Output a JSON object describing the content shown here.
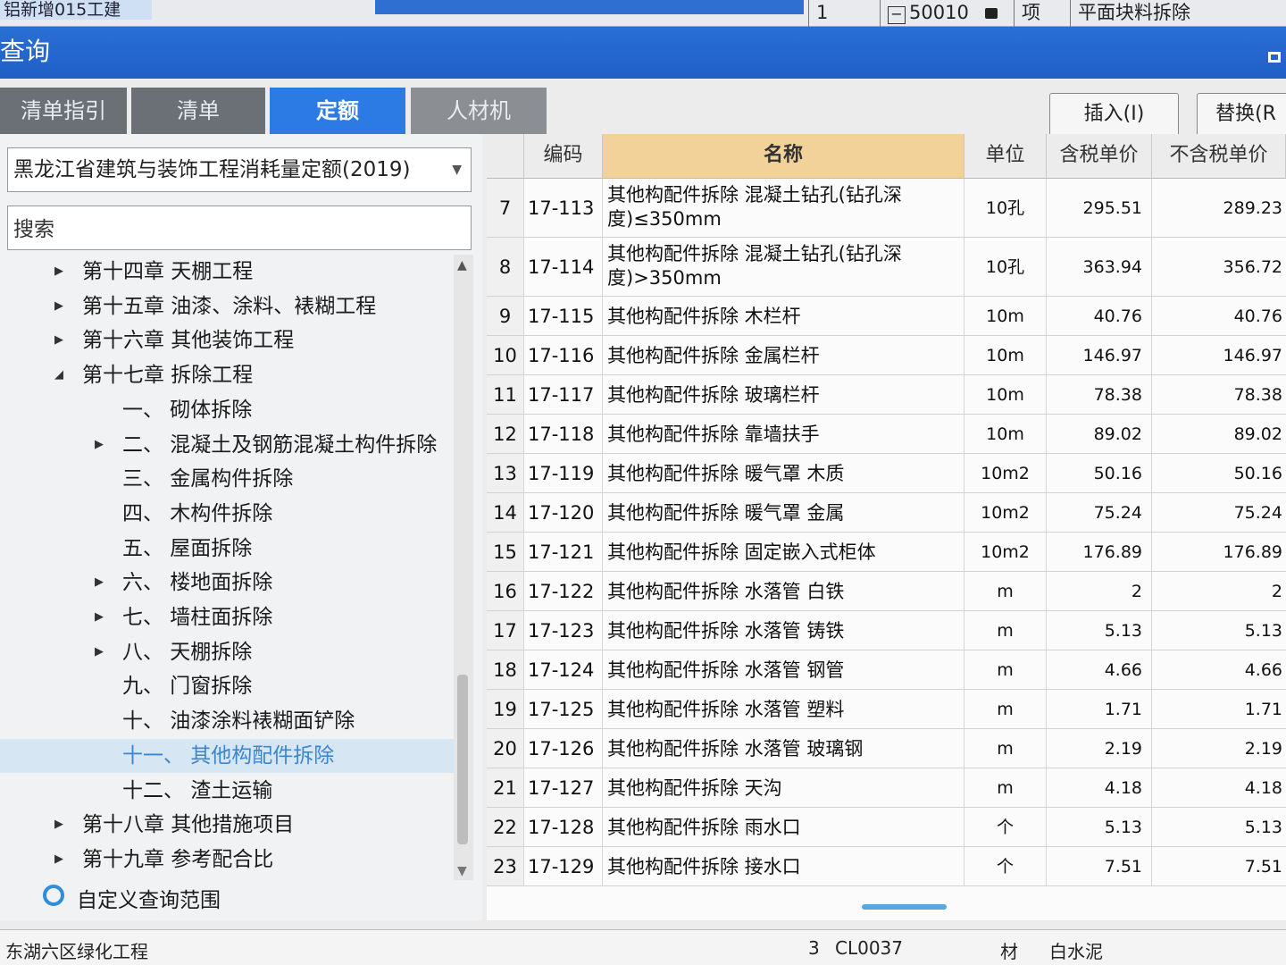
{
  "topbar": {
    "project": "铝新增015工建",
    "page_number": "1",
    "code": "50010",
    "type": "项",
    "item_name": "平面块料拆除"
  },
  "window": {
    "title": "查询"
  },
  "tabs": [
    {
      "label": "清单指引",
      "active": false
    },
    {
      "label": "清单",
      "active": false
    },
    {
      "label": "定额",
      "active": true
    },
    {
      "label": "人材机",
      "active": false
    }
  ],
  "actions": {
    "insert_label": "插入(I)",
    "replace_label": "替换(R"
  },
  "left_panel": {
    "library": "黑龙江省建筑与装饰工程消耗量定额(2019)",
    "search_placeholder": "搜索",
    "tree": [
      {
        "label": "第十四章 天棚工程",
        "state": "collapsed",
        "level": 0
      },
      {
        "label": "第十五章 油漆、涂料、裱糊工程",
        "state": "collapsed",
        "level": 0
      },
      {
        "label": "第十六章 其他装饰工程",
        "state": "collapsed",
        "level": 0
      },
      {
        "label": "第十七章 拆除工程",
        "state": "expanded",
        "level": 0
      },
      {
        "label": "一、 砌体拆除",
        "state": "leaf",
        "level": 1
      },
      {
        "label": "二、 混凝土及钢筋混凝土构件拆除",
        "state": "collapsed",
        "level": 1
      },
      {
        "label": "三、 金属构件拆除",
        "state": "leaf",
        "level": 1
      },
      {
        "label": "四、 木构件拆除",
        "state": "leaf",
        "level": 1
      },
      {
        "label": "五、 屋面拆除",
        "state": "leaf",
        "level": 1
      },
      {
        "label": "六、 楼地面拆除",
        "state": "collapsed",
        "level": 1
      },
      {
        "label": "七、 墙柱面拆除",
        "state": "collapsed",
        "level": 1
      },
      {
        "label": "八、 天棚拆除",
        "state": "collapsed",
        "level": 1
      },
      {
        "label": "九、 门窗拆除",
        "state": "leaf",
        "level": 1
      },
      {
        "label": "十、 油漆涂料裱糊面铲除",
        "state": "leaf",
        "level": 1
      },
      {
        "label": "十一、 其他构配件拆除",
        "state": "leaf",
        "level": 1,
        "selected": true
      },
      {
        "label": "十二、 渣土运输",
        "state": "leaf",
        "level": 1
      },
      {
        "label": "第十八章 其他措施项目",
        "state": "collapsed",
        "level": 0
      },
      {
        "label": "第十九章 参考配合比",
        "state": "collapsed",
        "level": 0
      }
    ],
    "custom_scope": "自定义查询范围"
  },
  "grid": {
    "headers": [
      "",
      "编码",
      "名称",
      "单位",
      "含税单价",
      "不含税单价"
    ],
    "rows": [
      {
        "no": "7",
        "code": "17-113",
        "name": "其他构配件拆除 混凝土钻孔(钻孔深度)≤350mm",
        "unit": "10孔",
        "price_tax": "295.51",
        "price_notax": "289.23"
      },
      {
        "no": "8",
        "code": "17-114",
        "name": "其他构配件拆除 混凝土钻孔(钻孔深度)>350mm",
        "unit": "10孔",
        "price_tax": "363.94",
        "price_notax": "356.72"
      },
      {
        "no": "9",
        "code": "17-115",
        "name": "其他构配件拆除 木栏杆",
        "unit": "10m",
        "price_tax": "40.76",
        "price_notax": "40.76"
      },
      {
        "no": "10",
        "code": "17-116",
        "name": "其他构配件拆除 金属栏杆",
        "unit": "10m",
        "price_tax": "146.97",
        "price_notax": "146.97"
      },
      {
        "no": "11",
        "code": "17-117",
        "name": "其他构配件拆除 玻璃栏杆",
        "unit": "10m",
        "price_tax": "78.38",
        "price_notax": "78.38"
      },
      {
        "no": "12",
        "code": "17-118",
        "name": "其他构配件拆除 靠墙扶手",
        "unit": "10m",
        "price_tax": "89.02",
        "price_notax": "89.02"
      },
      {
        "no": "13",
        "code": "17-119",
        "name": "其他构配件拆除 暖气罩 木质",
        "unit": "10m2",
        "price_tax": "50.16",
        "price_notax": "50.16"
      },
      {
        "no": "14",
        "code": "17-120",
        "name": "其他构配件拆除 暖气罩 金属",
        "unit": "10m2",
        "price_tax": "75.24",
        "price_notax": "75.24"
      },
      {
        "no": "15",
        "code": "17-121",
        "name": "其他构配件拆除 固定嵌入式柜体",
        "unit": "10m2",
        "price_tax": "176.89",
        "price_notax": "176.89"
      },
      {
        "no": "16",
        "code": "17-122",
        "name": "其他构配件拆除 水落管 白铁",
        "unit": "m",
        "price_tax": "2",
        "price_notax": "2"
      },
      {
        "no": "17",
        "code": "17-123",
        "name": "其他构配件拆除 水落管 铸铁",
        "unit": "m",
        "price_tax": "5.13",
        "price_notax": "5.13"
      },
      {
        "no": "18",
        "code": "17-124",
        "name": "其他构配件拆除 水落管 钢管",
        "unit": "m",
        "price_tax": "4.66",
        "price_notax": "4.66"
      },
      {
        "no": "19",
        "code": "17-125",
        "name": "其他构配件拆除 水落管 塑料",
        "unit": "m",
        "price_tax": "1.71",
        "price_notax": "1.71"
      },
      {
        "no": "20",
        "code": "17-126",
        "name": "其他构配件拆除 水落管 玻璃钢",
        "unit": "m",
        "price_tax": "2.19",
        "price_notax": "2.19"
      },
      {
        "no": "21",
        "code": "17-127",
        "name": "其他构配件拆除 天沟",
        "unit": "m",
        "price_tax": "4.18",
        "price_notax": "4.18"
      },
      {
        "no": "22",
        "code": "17-128",
        "name": "其他构配件拆除 雨水口",
        "unit": "个",
        "price_tax": "5.13",
        "price_notax": "5.13"
      },
      {
        "no": "23",
        "code": "17-129",
        "name": "其他构配件拆除 接水口",
        "unit": "个",
        "price_tax": "7.51",
        "price_notax": "7.51"
      }
    ]
  },
  "bottom": {
    "project": "东湖六区绿化工程",
    "row_no": "3",
    "code": "CL0037",
    "type": "材",
    "name": "白水泥"
  },
  "colors": {
    "title_bar": "#1f5fc6",
    "active_tab": "#2c7be5",
    "name_header": "#f3d29a",
    "selected_node": "#3b86d0"
  }
}
